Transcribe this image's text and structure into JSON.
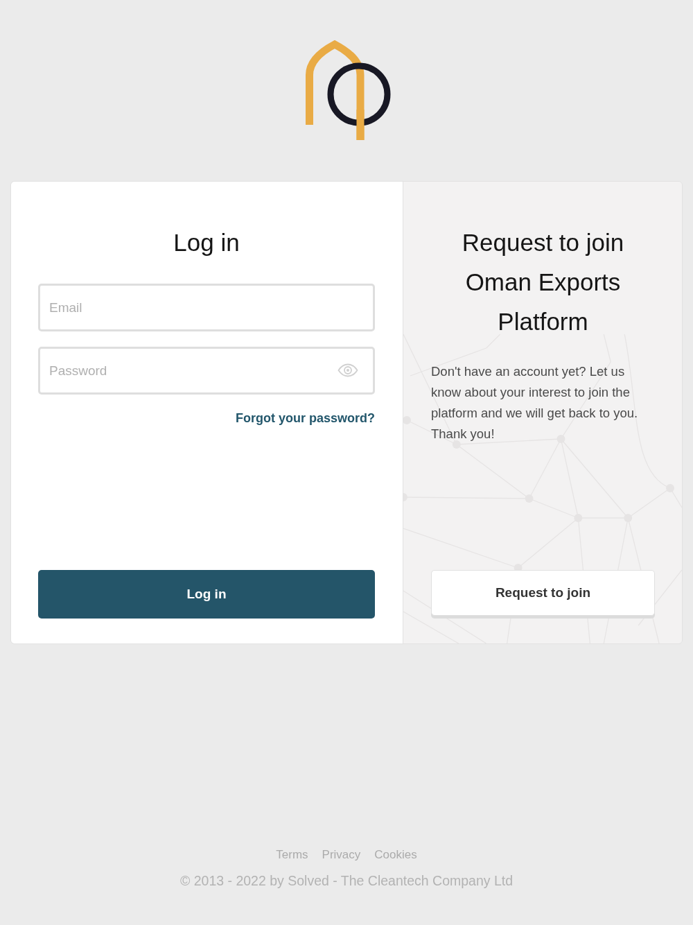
{
  "login": {
    "title": "Log in",
    "fields": [
      {
        "kind": "email",
        "placeholder": "Email"
      },
      {
        "kind": "password",
        "placeholder": "Password"
      }
    ],
    "forgot_link": "Forgot your password?",
    "submit_button": "Log in"
  },
  "request": {
    "title": "Request to join Oman Exports Platform",
    "text": "Don't have an account yet? Let us know about your interest to join the platform and we will get back to you. Thank you!",
    "button": "Request to join"
  },
  "footer": {
    "links": [
      "Terms",
      "Privacy",
      "Cookies"
    ],
    "copyright": "© 2013 - 2022 by Solved - The Cleantech Company Ltd"
  }
}
